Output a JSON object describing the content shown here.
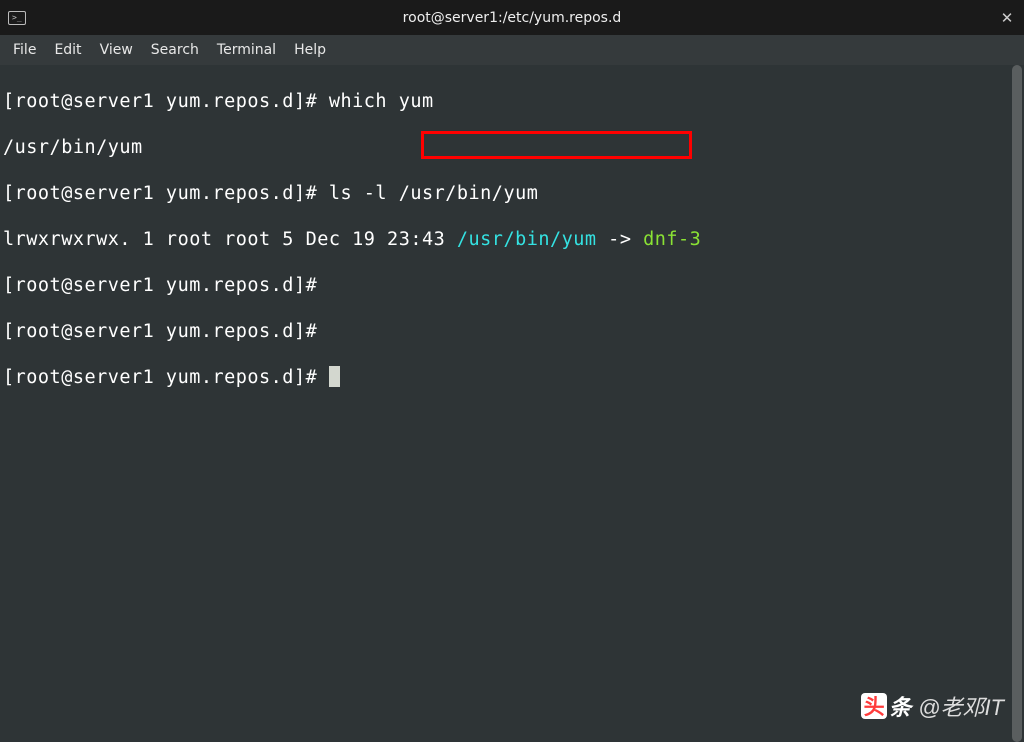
{
  "titlebar": {
    "title": "root@server1:/etc/yum.repos.d",
    "close": "✕"
  },
  "menu": {
    "file": "File",
    "edit": "Edit",
    "view": "View",
    "search": "Search",
    "terminal": "Terminal",
    "help": "Help"
  },
  "terminal": {
    "prompt": "[root@server1 yum.repos.d]# ",
    "line1_cmd": "which yum",
    "line2": "/usr/bin/yum",
    "line3_cmd": "ls -l /usr/bin/yum",
    "line4_perm": "lrwxrwxrwx. 1 root root 5 Dec 19 23:43 ",
    "line4_src": "/usr/bin/yum",
    "line4_arrow": " -> ",
    "line4_dst": "dnf-3"
  },
  "watermark": {
    "logo_char": "头",
    "logo_text": "条",
    "user": "@老邓IT"
  }
}
